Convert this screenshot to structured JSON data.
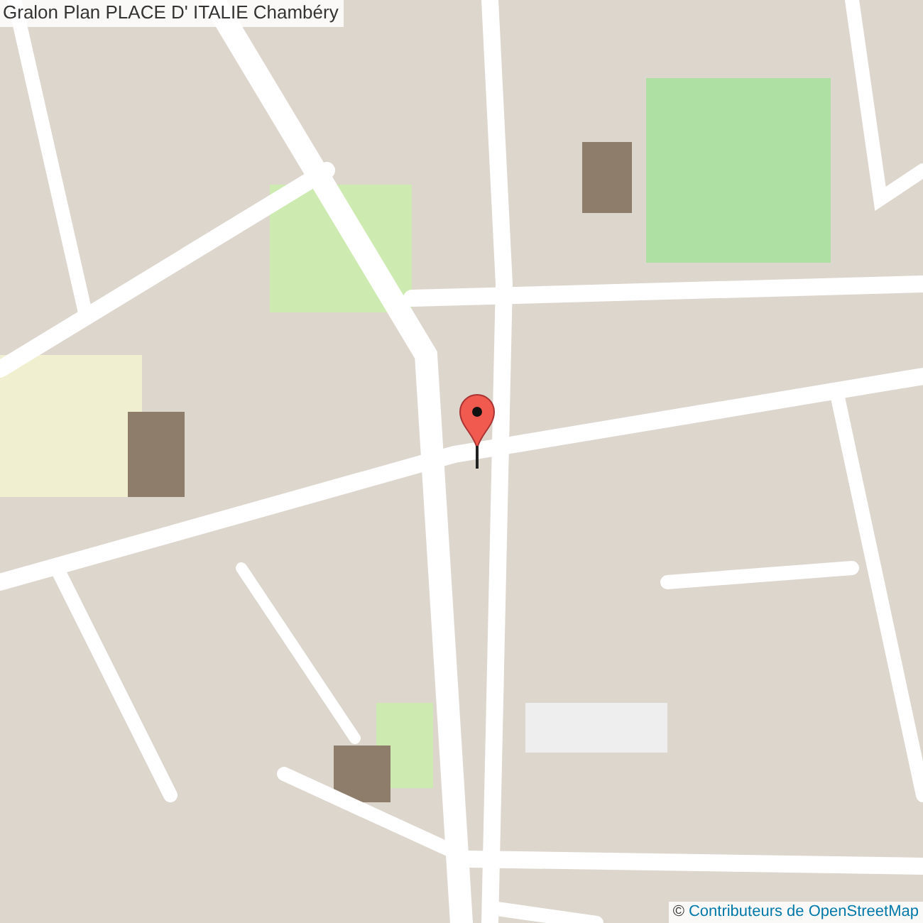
{
  "title": "Gralon Plan PLACE D' ITALIE Chambéry",
  "attribution": {
    "prefix": "©",
    "link": "Contributeurs de OpenStreetMap"
  }
}
